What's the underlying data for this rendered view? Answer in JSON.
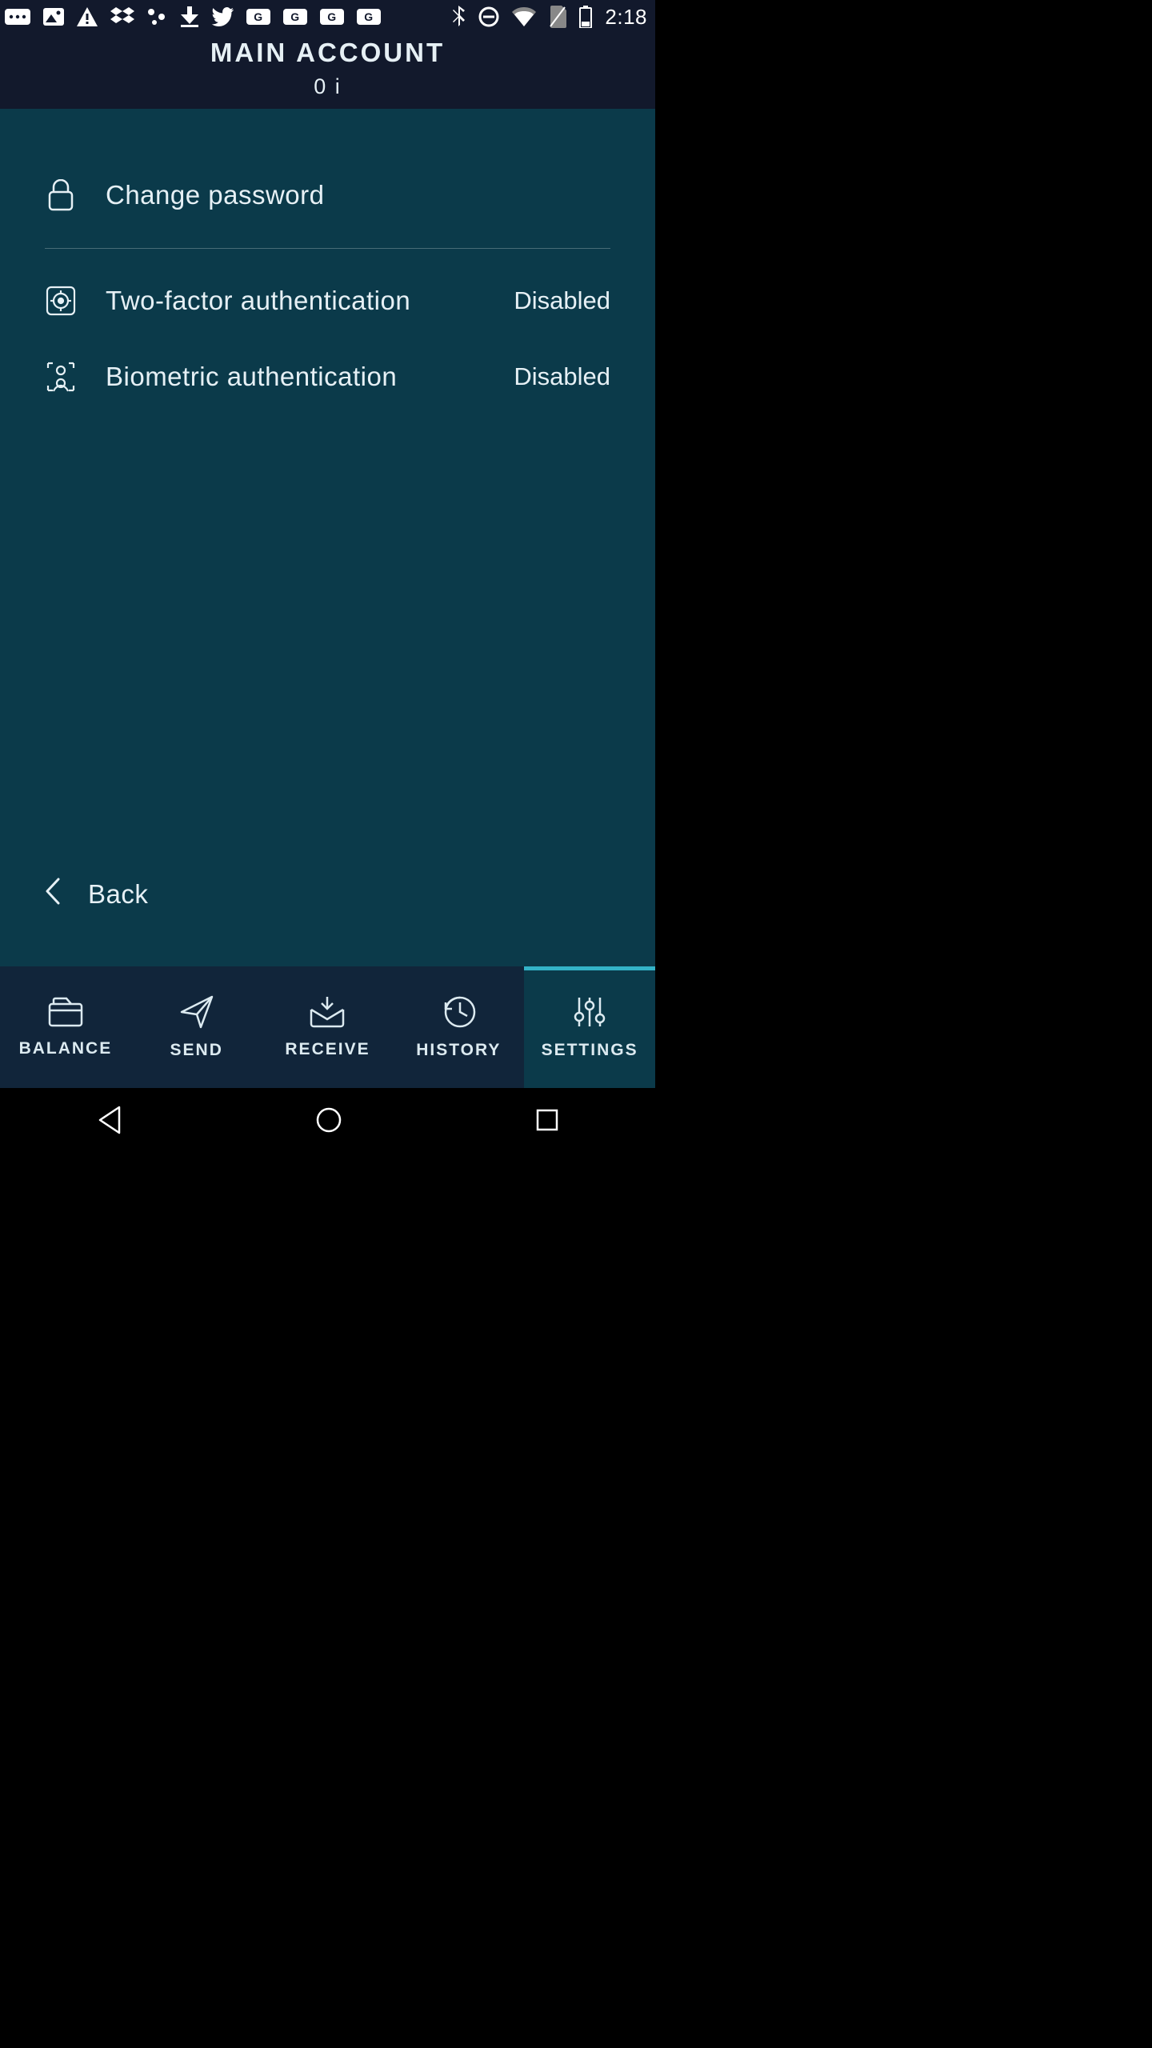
{
  "status_bar": {
    "time": "2:18"
  },
  "header": {
    "title": "MAIN ACCOUNT",
    "subtitle": "0 i"
  },
  "settings": {
    "change_password": "Change password",
    "two_factor": {
      "label": "Two-factor authentication",
      "status": "Disabled"
    },
    "biometric": {
      "label": "Biometric authentication",
      "status": "Disabled"
    },
    "back": "Back"
  },
  "nav": {
    "balance": "BALANCE",
    "send": "SEND",
    "receive": "RECEIVE",
    "history": "HISTORY",
    "settings": "SETTINGS"
  },
  "colors": {
    "header_bg": "#12192c",
    "body_bg": "#0b3a4a",
    "nav_bg": "#11253a",
    "accent": "#34b3c8"
  }
}
